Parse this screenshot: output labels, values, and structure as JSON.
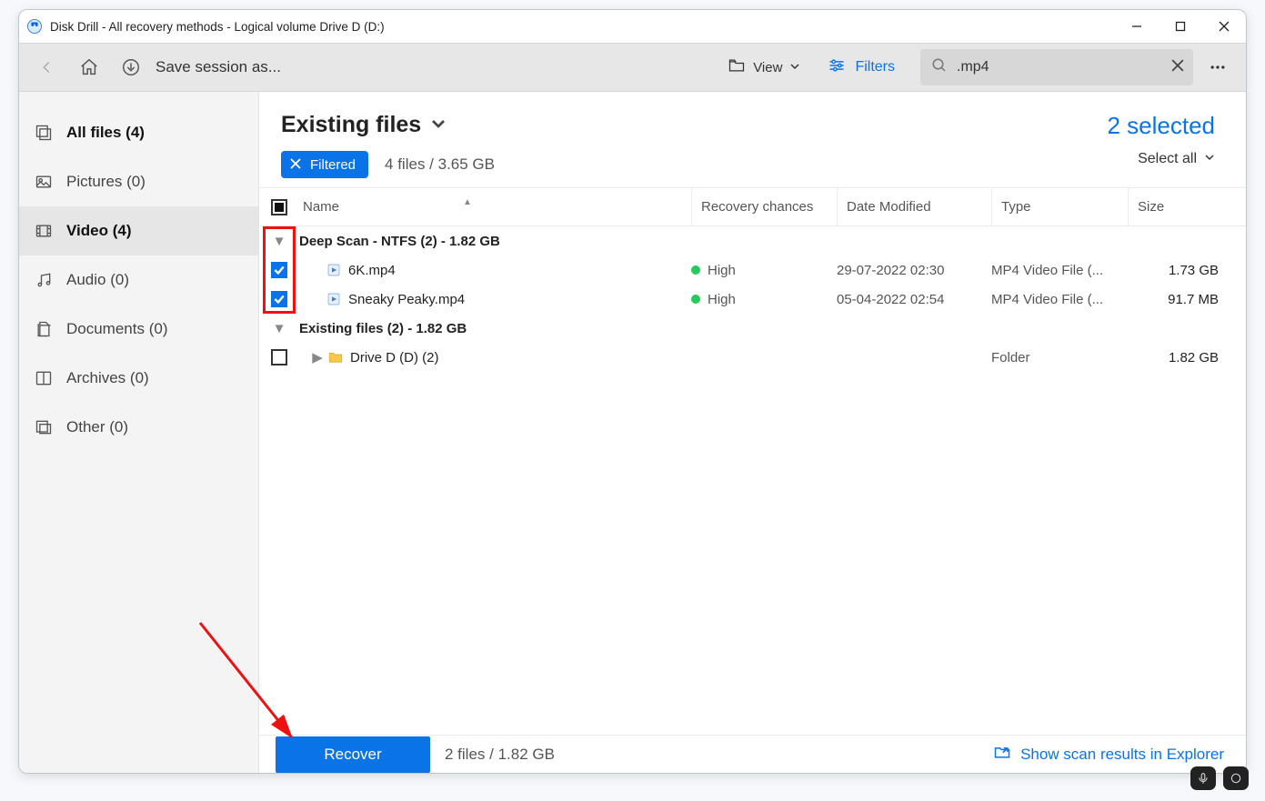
{
  "window": {
    "title": "Disk Drill - All recovery methods - Logical volume Drive D (D:)"
  },
  "toolbar": {
    "save_session": "Save session as...",
    "view_label": "View",
    "filters_label": "Filters",
    "search_value": ".mp4"
  },
  "sidebar": {
    "items": [
      {
        "label": "All files (4)"
      },
      {
        "label": "Pictures (0)"
      },
      {
        "label": "Video (4)"
      },
      {
        "label": "Audio (0)"
      },
      {
        "label": "Documents (0)"
      },
      {
        "label": "Archives (0)"
      },
      {
        "label": "Other (0)"
      }
    ]
  },
  "header": {
    "title": "Existing files",
    "filtered_label": "Filtered",
    "summary": "4 files / 3.65 GB",
    "selected_text": "2 selected",
    "select_all": "Select all"
  },
  "columns": {
    "name": "Name",
    "recovery": "Recovery chances",
    "date": "Date Modified",
    "type": "Type",
    "size": "Size"
  },
  "groups": [
    {
      "title": "Deep Scan - NTFS (2) - 1.82 GB",
      "rows": [
        {
          "checked": true,
          "name": "6K.mp4",
          "recovery": "High",
          "date": "29-07-2022 02:30",
          "type": "MP4 Video File (...",
          "size": "1.73 GB",
          "icon": "video"
        },
        {
          "checked": true,
          "name": "Sneaky Peaky.mp4",
          "recovery": "High",
          "date": "05-04-2022 02:54",
          "type": "MP4 Video File (...",
          "size": "91.7 MB",
          "icon": "video"
        }
      ]
    },
    {
      "title": "Existing files (2) - 1.82 GB",
      "rows": [
        {
          "checked": false,
          "name": "Drive D (D) (2)",
          "recovery": "",
          "date": "",
          "type": "Folder",
          "size": "1.82 GB",
          "icon": "folder"
        }
      ]
    }
  ],
  "footer": {
    "recover_label": "Recover",
    "summary": "2 files / 1.82 GB",
    "explorer_link": "Show scan results in Explorer"
  }
}
